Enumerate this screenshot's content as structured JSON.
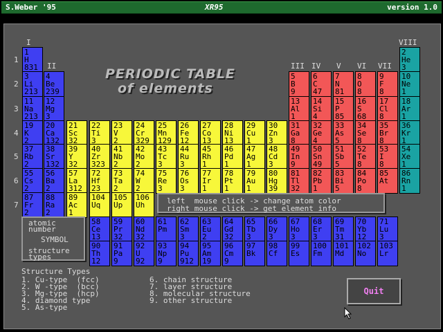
{
  "titlebar": {
    "author": "S.Weber '95",
    "app": "XR95",
    "version": "version 1.0"
  },
  "heading": {
    "line1": "PERIODIC TABLE",
    "line2": "of elements"
  },
  "groups": [
    "I",
    "II",
    "III",
    "IV",
    "V",
    "VI",
    "VII",
    "VIII"
  ],
  "periods": [
    "1",
    "2",
    "3",
    "4",
    "5",
    "6",
    "7"
  ],
  "elements": [
    {
      "n": "1",
      "s": "H",
      "t": "831",
      "c": "blue",
      "col": 0,
      "row": 0
    },
    {
      "n": "2",
      "s": "He",
      "t": "3",
      "c": "teal",
      "col": 17,
      "row": 0
    },
    {
      "n": "3",
      "s": "Li",
      "t": "213",
      "c": "blue",
      "col": 0,
      "row": 1
    },
    {
      "n": "4",
      "s": "Be",
      "t": "239",
      "c": "blue",
      "col": 1,
      "row": 1
    },
    {
      "n": "5",
      "s": "B",
      "t": "9",
      "c": "red",
      "col": 12,
      "row": 1
    },
    {
      "n": "6",
      "s": "C",
      "t": "47",
      "c": "red",
      "col": 13,
      "row": 1
    },
    {
      "n": "7",
      "s": "N",
      "t": "81",
      "c": "red",
      "col": 14,
      "row": 1
    },
    {
      "n": "8",
      "s": "O",
      "t": "8",
      "c": "red",
      "col": 15,
      "row": 1
    },
    {
      "n": "9",
      "s": "F",
      "t": "8",
      "c": "red",
      "col": 16,
      "row": 1
    },
    {
      "n": "10",
      "s": "Ne",
      "t": "1",
      "c": "teal",
      "col": 17,
      "row": 1
    },
    {
      "n": "11",
      "s": "Na",
      "t": "213",
      "c": "blue",
      "col": 0,
      "row": 2
    },
    {
      "n": "12",
      "s": "Mg",
      "t": "3",
      "c": "blue",
      "col": 1,
      "row": 2
    },
    {
      "n": "13",
      "s": "Al",
      "t": "1",
      "c": "red",
      "col": 12,
      "row": 2
    },
    {
      "n": "14",
      "s": "Si",
      "t": "4",
      "c": "red",
      "col": 13,
      "row": 2
    },
    {
      "n": "15",
      "s": "P",
      "t": "85",
      "c": "red",
      "col": 14,
      "row": 2
    },
    {
      "n": "16",
      "s": "S",
      "t": "68",
      "c": "red",
      "col": 15,
      "row": 2
    },
    {
      "n": "17",
      "s": "Cl",
      "t": "8",
      "c": "red",
      "col": 16,
      "row": 2
    },
    {
      "n": "18",
      "s": "Ar",
      "t": "1",
      "c": "teal",
      "col": 17,
      "row": 2
    },
    {
      "n": "19",
      "s": "K",
      "t": "2",
      "c": "blue",
      "col": 0,
      "row": 3
    },
    {
      "n": "20",
      "s": "Ca",
      "t": "132",
      "c": "blue",
      "col": 1,
      "row": 3
    },
    {
      "n": "21",
      "s": "Sc",
      "t": "32",
      "c": "yellow",
      "col": 2,
      "row": 3
    },
    {
      "n": "22",
      "s": "Ti",
      "t": "3",
      "c": "yellow",
      "col": 3,
      "row": 3
    },
    {
      "n": "23",
      "s": "V",
      "t": "2",
      "c": "yellow",
      "col": 4,
      "row": 3
    },
    {
      "n": "24",
      "s": "Cr",
      "t": "329",
      "c": "yellow",
      "col": 5,
      "row": 3
    },
    {
      "n": "25",
      "s": "Mn",
      "t": "129",
      "c": "yellow",
      "col": 6,
      "row": 3
    },
    {
      "n": "26",
      "s": "Fe",
      "t": "12",
      "c": "yellow",
      "col": 7,
      "row": 3
    },
    {
      "n": "27",
      "s": "Co",
      "t": "13",
      "c": "yellow",
      "col": 8,
      "row": 3
    },
    {
      "n": "28",
      "s": "Ni",
      "t": "13",
      "c": "yellow",
      "col": 9,
      "row": 3
    },
    {
      "n": "29",
      "s": "Cu",
      "t": "1",
      "c": "yellow",
      "col": 10,
      "row": 3
    },
    {
      "n": "30",
      "s": "Zn",
      "t": "3",
      "c": "yellow",
      "col": 11,
      "row": 3
    },
    {
      "n": "31",
      "s": "Ga",
      "t": "8",
      "c": "red",
      "col": 12,
      "row": 3
    },
    {
      "n": "32",
      "s": "Ge",
      "t": "4",
      "c": "red",
      "col": 13,
      "row": 3
    },
    {
      "n": "33",
      "s": "As",
      "t": "5",
      "c": "red",
      "col": 14,
      "row": 3
    },
    {
      "n": "34",
      "s": "Se",
      "t": "8",
      "c": "red",
      "col": 15,
      "row": 3
    },
    {
      "n": "35",
      "s": "Br",
      "t": "8",
      "c": "red",
      "col": 16,
      "row": 3
    },
    {
      "n": "36",
      "s": "Kr",
      "t": "1",
      "c": "teal",
      "col": 17,
      "row": 3
    },
    {
      "n": "37",
      "s": "Rb",
      "t": "2",
      "c": "blue",
      "col": 0,
      "row": 4
    },
    {
      "n": "38",
      "s": "Sr",
      "t": "132",
      "c": "blue",
      "col": 1,
      "row": 4
    },
    {
      "n": "39",
      "s": "Y",
      "t": "32",
      "c": "yellow",
      "col": 2,
      "row": 4
    },
    {
      "n": "40",
      "s": "Zr",
      "t": "323",
      "c": "yellow",
      "col": 3,
      "row": 4
    },
    {
      "n": "41",
      "s": "Nb",
      "t": "2",
      "c": "yellow",
      "col": 4,
      "row": 4
    },
    {
      "n": "42",
      "s": "Mo",
      "t": "2",
      "c": "yellow",
      "col": 5,
      "row": 4
    },
    {
      "n": "43",
      "s": "Tc",
      "t": "3",
      "c": "yellow",
      "col": 6,
      "row": 4
    },
    {
      "n": "44",
      "s": "Ru",
      "t": "3",
      "c": "yellow",
      "col": 7,
      "row": 4
    },
    {
      "n": "45",
      "s": "Rh",
      "t": "1",
      "c": "yellow",
      "col": 8,
      "row": 4
    },
    {
      "n": "46",
      "s": "Pd",
      "t": "1",
      "c": "yellow",
      "col": 9,
      "row": 4
    },
    {
      "n": "47",
      "s": "Ag",
      "t": "1",
      "c": "yellow",
      "col": 10,
      "row": 4
    },
    {
      "n": "48",
      "s": "Cd",
      "t": "3",
      "c": "yellow",
      "col": 11,
      "row": 4
    },
    {
      "n": "49",
      "s": "In",
      "t": "9",
      "c": "red",
      "col": 12,
      "row": 4
    },
    {
      "n": "50",
      "s": "Sn",
      "t": "49",
      "c": "red",
      "col": 13,
      "row": 4
    },
    {
      "n": "51",
      "s": "Sb",
      "t": "5",
      "c": "red",
      "col": 14,
      "row": 4
    },
    {
      "n": "52",
      "s": "Te",
      "t": "8",
      "c": "red",
      "col": 15,
      "row": 4
    },
    {
      "n": "53",
      "s": "I",
      "t": "8",
      "c": "red",
      "col": 16,
      "row": 4
    },
    {
      "n": "54",
      "s": "Xe",
      "t": "1",
      "c": "teal",
      "col": 17,
      "row": 4
    },
    {
      "n": "55",
      "s": "Cs",
      "t": "2",
      "c": "blue",
      "col": 0,
      "row": 5
    },
    {
      "n": "56",
      "s": "Ba",
      "t": "2",
      "c": "blue",
      "col": 1,
      "row": 5
    },
    {
      "n": "57",
      "s": "La",
      "t": "312",
      "c": "yellow",
      "col": 2,
      "row": 5
    },
    {
      "n": "72",
      "s": "Hf",
      "t": "23",
      "c": "yellow",
      "col": 3,
      "row": 5
    },
    {
      "n": "73",
      "s": "Ta",
      "t": "2",
      "c": "yellow",
      "col": 4,
      "row": 5
    },
    {
      "n": "74",
      "s": "W",
      "t": "2",
      "c": "yellow",
      "col": 5,
      "row": 5
    },
    {
      "n": "75",
      "s": "Re",
      "t": "3",
      "c": "yellow",
      "col": 6,
      "row": 5
    },
    {
      "n": "76",
      "s": "Os",
      "t": "3",
      "c": "yellow",
      "col": 7,
      "row": 5
    },
    {
      "n": "77",
      "s": "Ir",
      "t": "1",
      "c": "yellow",
      "col": 8,
      "row": 5
    },
    {
      "n": "78",
      "s": "Pt",
      "t": "1",
      "c": "yellow",
      "col": 9,
      "row": 5
    },
    {
      "n": "79",
      "s": "Au",
      "t": "1",
      "c": "yellow",
      "col": 10,
      "row": 5
    },
    {
      "n": "80",
      "s": "Hg",
      "t": "39",
      "c": "yellow",
      "col": 11,
      "row": 5
    },
    {
      "n": "81",
      "s": "Tl",
      "t": "32",
      "c": "red",
      "col": 12,
      "row": 5
    },
    {
      "n": "82",
      "s": "Pb",
      "t": "1",
      "c": "red",
      "col": 13,
      "row": 5
    },
    {
      "n": "83",
      "s": "Bi",
      "t": "5",
      "c": "red",
      "col": 14,
      "row": 5
    },
    {
      "n": "84",
      "s": "Po",
      "t": "8",
      "c": "red",
      "col": 15,
      "row": 5
    },
    {
      "n": "85",
      "s": "At",
      "t": "",
      "c": "red",
      "col": 16,
      "row": 5
    },
    {
      "n": "86",
      "s": "Rn",
      "t": "1",
      "c": "teal",
      "col": 17,
      "row": 5
    },
    {
      "n": "87",
      "s": "Fr",
      "t": "2",
      "c": "blue",
      "col": 0,
      "row": 6
    },
    {
      "n": "88",
      "s": "Ra",
      "t": "2",
      "c": "blue",
      "col": 1,
      "row": 6
    },
    {
      "n": "89",
      "s": "Ac",
      "t": "1",
      "c": "yellow",
      "col": 2,
      "row": 6
    },
    {
      "n": "104",
      "s": "Uq",
      "t": "",
      "c": "yellow",
      "col": 3,
      "row": 6
    },
    {
      "n": "105",
      "s": "Up",
      "t": "",
      "c": "yellow",
      "col": 4,
      "row": 6
    },
    {
      "n": "106",
      "s": "Uh",
      "t": "",
      "c": "yellow",
      "col": 5,
      "row": 6
    }
  ],
  "lanthanides": [
    {
      "n": "58",
      "s": "Ce",
      "t": "13"
    },
    {
      "n": "59",
      "s": "Pr",
      "t": "32"
    },
    {
      "n": "60",
      "s": "Nd",
      "t": "32"
    },
    {
      "n": "61",
      "s": "Pm",
      "t": ""
    },
    {
      "n": "62",
      "s": "Sm",
      "t": "3"
    },
    {
      "n": "63",
      "s": "Eu",
      "t": "2"
    },
    {
      "n": "64",
      "s": "Gd",
      "t": "32"
    },
    {
      "n": "65",
      "s": "Tb",
      "t": "3"
    },
    {
      "n": "66",
      "s": "Dy",
      "t": "3"
    },
    {
      "n": "67",
      "s": "Ho",
      "t": "3"
    },
    {
      "n": "68",
      "s": "Er",
      "t": "3"
    },
    {
      "n": "69",
      "s": "Tm",
      "t": "31"
    },
    {
      "n": "70",
      "s": "Yb",
      "t": "12"
    },
    {
      "n": "71",
      "s": "Lu",
      "t": "3"
    }
  ],
  "actinides": [
    {
      "n": "90",
      "s": "Th",
      "t": "12"
    },
    {
      "n": "91",
      "s": "Pa",
      "t": "9"
    },
    {
      "n": "92",
      "s": "U",
      "t": "92"
    },
    {
      "n": "93",
      "s": "Np",
      "t": "9"
    },
    {
      "n": "94",
      "s": "Pu",
      "t": "912"
    },
    {
      "n": "95",
      "s": "Am",
      "t": "19"
    },
    {
      "n": "96",
      "s": "Cm",
      "t": "9"
    },
    {
      "n": "97",
      "s": "Bk",
      "t": ""
    },
    {
      "n": "98",
      "s": "Cf",
      "t": ""
    },
    {
      "n": "99",
      "s": "Es",
      "t": ""
    },
    {
      "n": "100",
      "s": "Fm",
      "t": ""
    },
    {
      "n": "101",
      "s": "Md",
      "t": ""
    },
    {
      "n": "102",
      "s": "No",
      "t": ""
    },
    {
      "n": "103",
      "s": "Lr",
      "t": ""
    }
  ],
  "help": {
    "line1": "left  mouse click -> change atom color",
    "line2": "right mouse click -> get element info"
  },
  "legend": {
    "l1": "atomic",
    "l2": "number",
    "l3": "SYMBOL",
    "l4": "structure",
    "l5": "types"
  },
  "structure_types": {
    "title": "Structure Types",
    "left": [
      "1. Cu-type  (fcc)",
      "2. W -type  (bcc)",
      "3. Mg-type  (hcp)",
      "4. diamond type",
      "5. As-type"
    ],
    "right": [
      "6. chain structure",
      "7. layer structure",
      "8. molecular structure",
      "9. other structure"
    ]
  },
  "quit_label": "Quit",
  "colors": {
    "blue": "#3f3ff2",
    "yellow": "#f7f73a",
    "red": "#f25757",
    "teal": "#1aa3a3",
    "titlebar": "#1e6a2e",
    "quit_text": "#f07ff0"
  }
}
